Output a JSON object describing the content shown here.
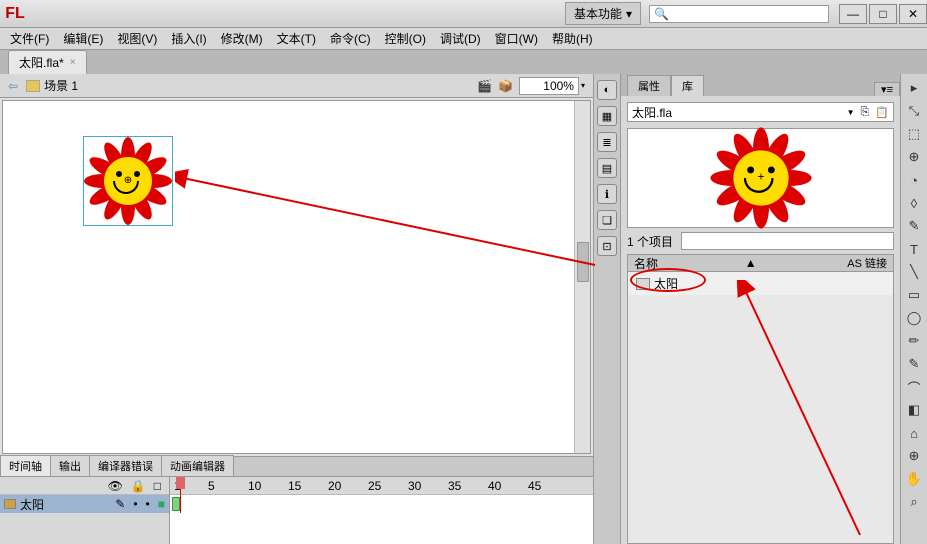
{
  "app": {
    "logo": "FL"
  },
  "workspace": {
    "label": "基本功能",
    "search_placeholder": ""
  },
  "winbtns": {
    "min": "—",
    "max": "□",
    "close": "✕"
  },
  "menu": {
    "file": "文件(F)",
    "edit": "编辑(E)",
    "view": "视图(V)",
    "insert": "插入(I)",
    "modify": "修改(M)",
    "text": "文本(T)",
    "commands": "命令(C)",
    "control": "控制(O)",
    "debug": "调试(D)",
    "window": "窗口(W)",
    "help": "帮助(H)"
  },
  "doc": {
    "tab_label": "太阳.fla*",
    "close": "×"
  },
  "scene": {
    "back": "⇦",
    "name": "场景 1",
    "zoom": "100%"
  },
  "timeline": {
    "tabs": {
      "timeline": "时间轴",
      "output": "输出",
      "compiler": "编译器错误",
      "motion": "动画编辑器"
    },
    "layer_name": "太阳",
    "ruler": [
      "1",
      "5",
      "10",
      "15",
      "20",
      "25",
      "30",
      "35",
      "40",
      "45"
    ]
  },
  "rightpanel": {
    "tab_props": "属性",
    "tab_lib": "库",
    "doc_dd": "太阳.fla",
    "items_count": "1 个项目",
    "search_placeholder": "",
    "col_name": "名称",
    "col_as": "AS 链接",
    "item_name": "太阳"
  },
  "iconstrip": [
    "◐",
    "▦",
    "≣",
    "▤",
    "ℹ",
    "❏",
    "⊡"
  ],
  "tools": [
    "▸",
    "⤡",
    "⬚",
    "⊕",
    "◔",
    "◊",
    "⬭",
    "✎",
    "T",
    "╲",
    "▭",
    "◯",
    "✏",
    "✎",
    "⌒",
    "◧",
    "⌂",
    "⊕",
    "✋",
    "⌕"
  ]
}
